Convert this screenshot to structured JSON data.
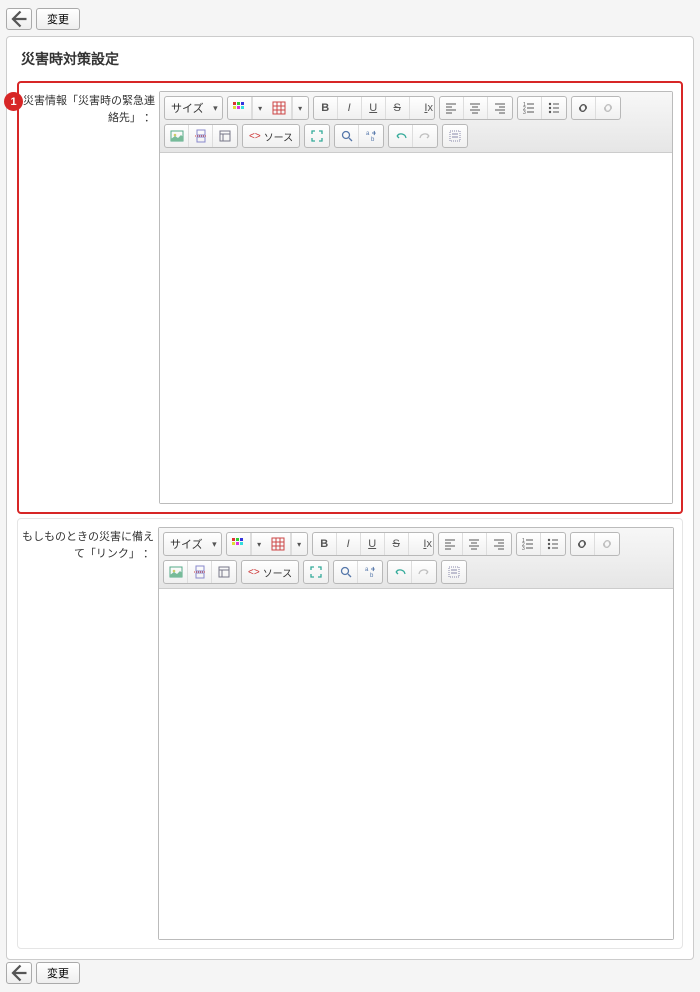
{
  "buttons": {
    "change": "変更"
  },
  "section_title": "災害時対策設定",
  "fields": [
    {
      "label": "災害情報「災害時の緊急連絡先」",
      "highlight": true,
      "badge": "1"
    },
    {
      "label": "もしものときの災害に備えて「リンク」",
      "highlight": false
    }
  ],
  "toolbar": {
    "size_label": "サイズ",
    "source_label": "ソース"
  }
}
